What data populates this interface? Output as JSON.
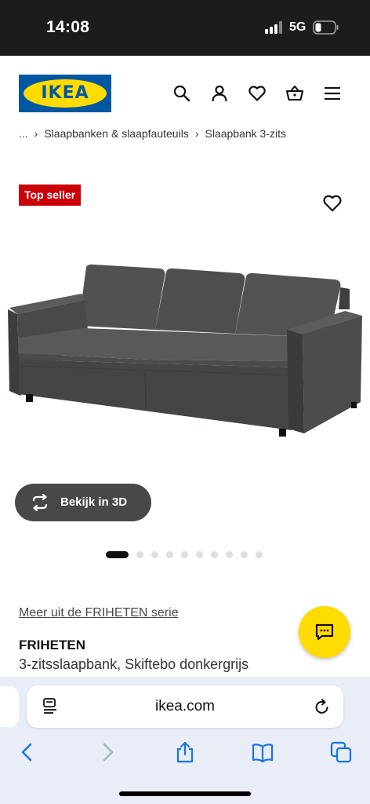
{
  "status_bar": {
    "time": "14:08",
    "network": "5G"
  },
  "header": {
    "logo_text": "IKEA",
    "icons": [
      "search-icon",
      "account-icon",
      "heart-icon",
      "basket-icon",
      "menu-icon"
    ]
  },
  "breadcrumb": {
    "items": [
      "...",
      "Slaapbanken & slaapfauteuils",
      "Slaapbank 3-zits"
    ]
  },
  "product": {
    "badge": "Top seller",
    "view_3d_label": "Bekijk in 3D",
    "carousel_total": 10,
    "carousel_active": 1,
    "series_link": "Meer uit de FRIHETEN serie",
    "name": "FRIHETEN",
    "description": "3-zitsslaapbank, Skiftebo donkergrijs"
  },
  "browser": {
    "url": "ikea.com"
  },
  "colors": {
    "ikea_blue": "#0058a3",
    "ikea_yellow": "#ffdb00",
    "badge_red": "#cc0008",
    "sofa_gray": "#4a4b4d"
  }
}
